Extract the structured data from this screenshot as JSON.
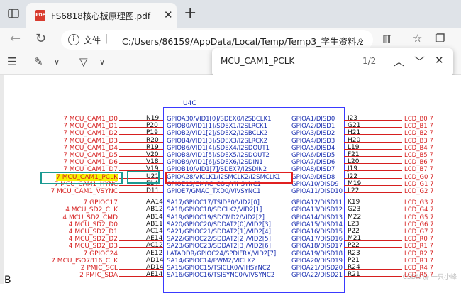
{
  "tab": {
    "title": "FS6818核心板原理图.pdf",
    "pdf_badge": "PDF"
  },
  "address": {
    "file_label": "文件",
    "url": "C:/Users/86159/AppData/Local/Temp/Temp3_学生资料.zip..."
  },
  "find": {
    "query": "MCU_CAM1_PCLK",
    "count": "1/2"
  },
  "chip": {
    "name": "U4C"
  },
  "left_nets": [
    {
      "text": "7  MCU_CAM1_D0"
    },
    {
      "text": "7  MCU_CAM1_D1"
    },
    {
      "text": "7  MCU_CAM1_D2"
    },
    {
      "text": "7  MCU_CAM1_D3"
    },
    {
      "text": "7  MCU_CAM1_D4"
    },
    {
      "text": "7  MCU_CAM1_D5"
    },
    {
      "text": "7  MCU_CAM1_D6"
    },
    {
      "text": "7  MCU_CAM1_D7"
    },
    {
      "text": "7  MCU_CAM1_PCLK"
    },
    {
      "text": "7  MCU_CAM1_HYNC"
    },
    {
      "text": "7  MCU_CAM1_VSYNC"
    },
    {
      "text": "7  GPIOC17"
    },
    {
      "text": "4  MCU_SD2_CLK"
    },
    {
      "text": "4  MCU_SD2_CMD"
    },
    {
      "text": "4  MCU_SD2_D0"
    },
    {
      "text": "4  MCU_SD2_D1"
    },
    {
      "text": "4  MCU_SD2_D2"
    },
    {
      "text": "4  MCU_SD2_D3"
    },
    {
      "text": "7  GPIOC24"
    },
    {
      "text": "7  MCU_ISO7816_CLK"
    },
    {
      "text": "2  PMIC_SCL"
    },
    {
      "text": "2  PMIC_SDA"
    }
  ],
  "left_pins": [
    "N19",
    "P20",
    "P19",
    "R20",
    "R19",
    "V20",
    "V18",
    "V19",
    "U21",
    "E14",
    "D11",
    "AA14",
    "AB12",
    "AB14",
    "AB11",
    "AC14",
    "AE14",
    "AC12",
    "AE12",
    "AD14",
    "AD14",
    "AE14"
  ],
  "left_funcs": [
    "GPIOA30/VID1[0]/SDEX0/I2SBCLK1",
    "GPIOB0/VID1[1]/SDEX1/I2SLRCK1",
    "GPIOB2/VID1[2]/SDEX2/I2SBCLK2",
    "GPIOB4/VID1[3]/SDEX3/I2SLRCK2",
    "GPIOB6/VID1[4]/SDEX4/I2SDOUT1",
    "GPIOB8/VID1[5]/SDEX5/I2SDOUT2",
    "GPIOB9/VID1[6]/SDEX6/I2SDIN1",
    "GPIOB10/VID1[7]/SDEX7/I2SDIN2",
    "GPIOA28/VICLK1/I2SMCLK2/I2SMCLK1",
    "GPIOE13/GMAC_COL/VIHSYNC1",
    "GPIOE7/GMAC_TXD0/VIVSYNC1",
    "SA17/GPIOC17/TSIDP0/VID2[0]",
    "SA18/GPIOC18/SDCLK2/VID2[1]",
    "SA19/GPIOC19/SDCMD2/VID2[2]",
    "SA20/GPIOC20/SDDAT2[0]/VID2[3]",
    "SA21/GPIOC21/SDDAT2[1]/VID2[4]",
    "SA22/GPIOC22/SDDAT2[2]/VID2[5]",
    "SA23/GPIOC23/SDDAT2[3]/VID2[6]",
    "LATADDR/GPIOC24/SPDIFRX/VID2[7]",
    "SA14/GPIOC14/PWM2/VICLK2",
    "SA15/GPIOC15/TSICLK0/VIHSYNC2",
    "SA16/GPIOC16/TSISYNC0/VIVSYNC2"
  ],
  "right_funcs": [
    "GPIOA1/DISD0",
    "GPIOA2/DISD1",
    "GPIOA3/DISD2",
    "GPIOA4/DISD3",
    "GPIOA5/DISD4",
    "GPIOA6/DISD5",
    "GPIOA7/DISD6",
    "GPIOA8/DISD7",
    "GPIOA9/DISD8",
    "GPIOA10/DISD9",
    "GPIOA11/DISD10",
    "GPIOA12/DISD11",
    "GPIOA13/DISD12",
    "GPIOA14/DISD13",
    "GPIOA15/DISD14",
    "GPIOA16/DISD15",
    "GPIOA17/DISD16",
    "GPIOA18/DISD17",
    "GPIOA19/DISD18",
    "GPIOA20/DISD19",
    "GPIOA21/DISD20",
    "GPIOA22/DISD21"
  ],
  "right_pins": [
    "J23",
    "G21",
    "H21",
    "H20",
    "L19",
    "F21",
    "L20",
    "J19",
    "J22",
    "M19",
    "L22",
    "K19",
    "G23",
    "M22",
    "L23",
    "P22",
    "M21",
    "P22",
    "R23",
    "P21",
    "R24",
    "R21"
  ],
  "right_nets": [
    "LCD_B0  7",
    "LCD_B1  7",
    "LCD_B2  7",
    "LCD_B3  7",
    "LCD_B4  7",
    "LCD_B5  7",
    "LCD_B6  7",
    "LCD_B7  7",
    "LCD_G0  7",
    "LCD_G1  7",
    "LCD_G2  7",
    "LCD_G3  7",
    "LCD_G4  7",
    "LCD_G5  7",
    "LCD_G6  7",
    "LCD_G7  7",
    "LCD_R0  7",
    "LCD_R1  7",
    "LCD_R2  7",
    "LCD_R3  7",
    "LCD_R4  7",
    "LCD_R5  7"
  ],
  "side_letter": "B",
  "watermark": "CSDN @ 一只小峰",
  "colors": {
    "net_red": "#d61f1f",
    "chip_blue": "#3a3aff",
    "highlight": "#f5f500",
    "teal": "#1b9a92"
  }
}
